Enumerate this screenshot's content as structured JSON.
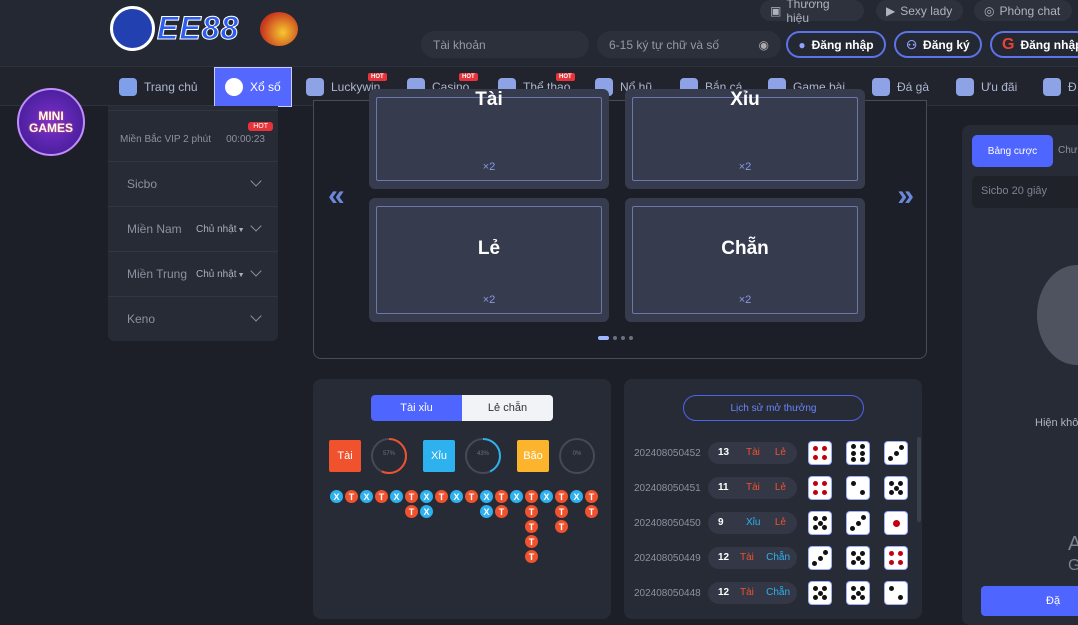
{
  "header": {
    "logo_text": "EE88",
    "top_links": [
      {
        "label": "Thương hiệu",
        "icon": "camera-icon"
      },
      {
        "label": "Sexy lady",
        "icon": "play-icon"
      },
      {
        "label": "Phòng chat",
        "icon": "chat-icon"
      }
    ],
    "username_placeholder": "Tài khoản",
    "password_placeholder": "6-15 ký tự chữ và số",
    "login_label": "Đăng nhập",
    "register_label": "Đăng ký",
    "google_login_label": "Đăng nhập"
  },
  "nav": {
    "items": [
      {
        "label": "Trang chủ",
        "hot": false
      },
      {
        "label": "Xổ số",
        "hot": false,
        "active": true
      },
      {
        "label": "Luckywin",
        "hot": true
      },
      {
        "label": "Casino",
        "hot": true
      },
      {
        "label": "Thể thao",
        "hot": true
      },
      {
        "label": "Nổ hũ",
        "hot": false
      },
      {
        "label": "Bắn cá",
        "hot": false
      },
      {
        "label": "Game bài",
        "hot": false
      },
      {
        "label": "Đá gà",
        "hot": false
      },
      {
        "label": "Ưu đãi",
        "hot": false
      },
      {
        "label": "Đ",
        "hot": false
      }
    ],
    "hot_label": "HOT",
    "accent": "#5468ff"
  },
  "mini_games": {
    "logo_text": "MINI GAMES"
  },
  "sidebar": {
    "featured": {
      "name": "Miền Bắc VIP 2 phút",
      "timer": "00:00:23",
      "badge": "HOT"
    },
    "items": [
      {
        "label": "Sicbo",
        "day": ""
      },
      {
        "label": "Miền Nam",
        "day": "Chủ nhật"
      },
      {
        "label": "Miền Trung",
        "day": "Chủ nhật"
      },
      {
        "label": "Keno",
        "day": ""
      }
    ]
  },
  "bets": {
    "cards": [
      {
        "label": "Tài",
        "multiplier": "×2"
      },
      {
        "label": "Xỉu",
        "multiplier": "×2"
      },
      {
        "label": "Lẻ",
        "multiplier": "×2"
      },
      {
        "label": "Chẵn",
        "multiplier": "×2"
      }
    ],
    "page": 1,
    "pages": 4
  },
  "stats": {
    "tabs": [
      {
        "label": "Tài xỉu",
        "active": true
      },
      {
        "label": "Lẻ chẵn",
        "active": false
      }
    ],
    "summary": [
      {
        "label": "Tài",
        "percent": 57,
        "percent_label": "57%",
        "color": "#f0522e"
      },
      {
        "label": "Xỉu",
        "percent": 43,
        "percent_label": "43%",
        "color": "#2db2ef"
      },
      {
        "label": "Bão",
        "percent": 0,
        "percent_label": "0%",
        "color": "#fbb42c"
      }
    ],
    "road": [
      [
        "X"
      ],
      [
        "T"
      ],
      [
        "X"
      ],
      [
        "T"
      ],
      [
        "X"
      ],
      [
        "T",
        "T"
      ],
      [
        "X",
        "X"
      ],
      [
        "T"
      ],
      [
        "X"
      ],
      [
        "T"
      ],
      [
        "X",
        "X"
      ],
      [
        "T",
        "T"
      ],
      [
        "X"
      ],
      [
        "T",
        "T",
        "T",
        "T",
        "T"
      ],
      [
        "X"
      ],
      [
        "T",
        "T",
        "T"
      ],
      [
        "X"
      ],
      [
        "T",
        "T"
      ]
    ]
  },
  "history": {
    "title": "Lịch sử mở thưởng",
    "rows": [
      {
        "id": "202408050452",
        "sum": "13",
        "size": "Tài",
        "parity": "Lẻ",
        "dice": [
          4,
          6,
          3
        ]
      },
      {
        "id": "202408050451",
        "sum": "11",
        "size": "Tài",
        "parity": "Lẻ",
        "dice": [
          4,
          2,
          5
        ]
      },
      {
        "id": "202408050450",
        "sum": "9",
        "size": "Xỉu",
        "parity": "Lẻ",
        "dice": [
          5,
          3,
          1
        ]
      },
      {
        "id": "202408050449",
        "sum": "12",
        "size": "Tài",
        "parity": "Chẵn",
        "dice": [
          3,
          5,
          4
        ]
      },
      {
        "id": "202408050448",
        "sum": "12",
        "size": "Tài",
        "parity": "Chẵn",
        "dice": [
          5,
          5,
          2
        ]
      }
    ]
  },
  "right_panel": {
    "tabs": [
      {
        "label": "Bảng cược",
        "active": true
      },
      {
        "label": "Chưa"
      }
    ],
    "game": "Sicbo 20 giây",
    "empty_text": "Hiện khô",
    "line1": "A",
    "line2": "G",
    "button": "Đặ"
  }
}
